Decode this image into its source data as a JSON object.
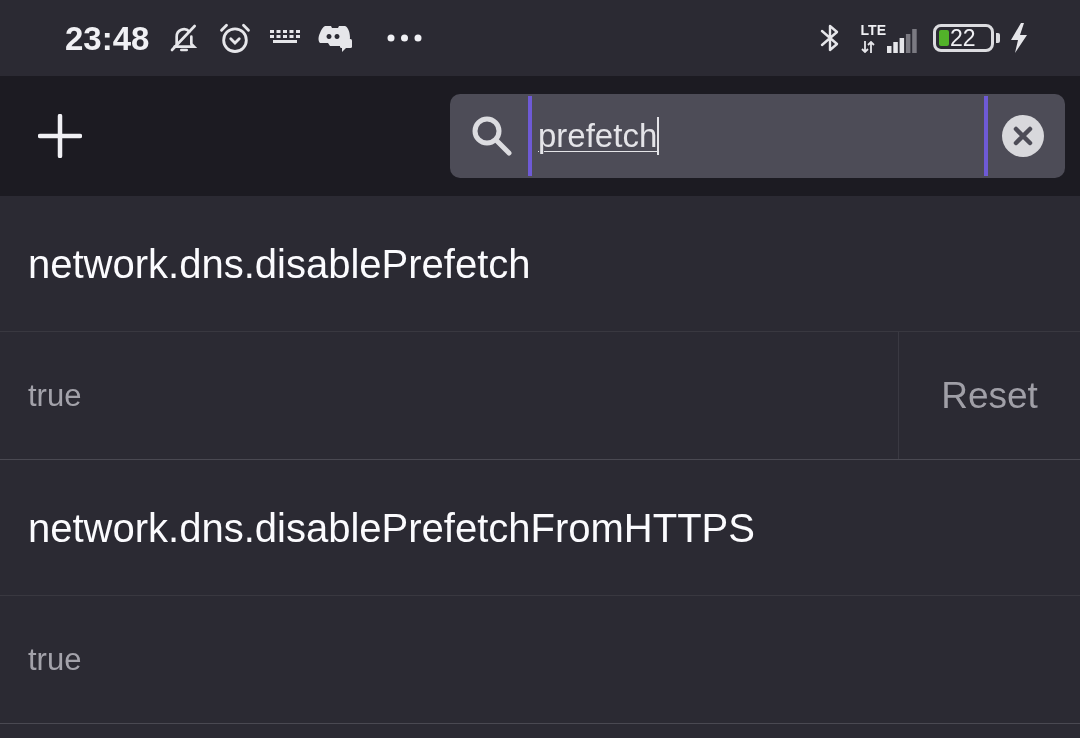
{
  "status_bar": {
    "time": "23:48",
    "network_type": "LTE",
    "battery_percent": "22"
  },
  "toolbar": {
    "search": {
      "value": "prefetch"
    }
  },
  "prefs": [
    {
      "name": "network.dns.disablePrefetch",
      "value": "true",
      "reset_button": "Reset"
    },
    {
      "name": "network.dns.disablePrefetchFromHTTPS",
      "value": "true"
    }
  ]
}
